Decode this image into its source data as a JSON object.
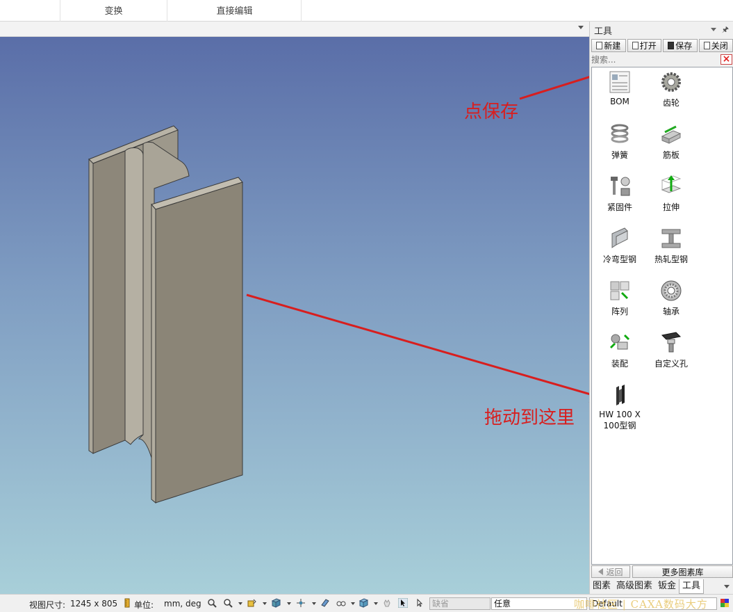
{
  "ribbon": {
    "tabs": [
      "变换",
      "直接编辑"
    ]
  },
  "panel": {
    "title": "工具",
    "pin_icon": "pin-icon",
    "toolbar": {
      "new_label": "新建",
      "open_label": "打开",
      "save_label": "保存",
      "close_label": "关闭"
    },
    "search": {
      "placeholder": "搜索...",
      "value": ""
    },
    "items": [
      {
        "label": "BOM",
        "icon": "bom-icon"
      },
      {
        "label": "齿轮",
        "icon": "gear-icon"
      },
      {
        "label": "弹簧",
        "icon": "spring-icon"
      },
      {
        "label": "筋板",
        "icon": "rib-icon"
      },
      {
        "label": "紧固件",
        "icon": "fastener-icon"
      },
      {
        "label": "拉伸",
        "icon": "extrude-icon"
      },
      {
        "label": "冷弯型钢",
        "icon": "cold-formed-steel-icon"
      },
      {
        "label": "热轧型钢",
        "icon": "hot-rolled-steel-icon"
      },
      {
        "label": "阵列",
        "icon": "array-icon"
      },
      {
        "label": "轴承",
        "icon": "bearing-icon"
      },
      {
        "label": "装配",
        "icon": "assembly-icon"
      },
      {
        "label": "自定义孔",
        "icon": "custom-hole-icon"
      },
      {
        "label": "HW 100 X 100型钢",
        "icon": "h-beam-icon"
      }
    ],
    "nav": {
      "back_label": "返回",
      "more_label": "更多图素库"
    },
    "tabs": [
      "图素",
      "高级图素",
      "钣金",
      "工具"
    ],
    "active_tab": "工具"
  },
  "annotations": {
    "save_hint": "点保存",
    "drag_hint": "拖动到这里"
  },
  "status": {
    "view_size_label": "视图尺寸:",
    "view_size_value": "1245 x  805",
    "unit_label": "单位:",
    "unit_value": "mm, deg",
    "combo_default_left": "缺省",
    "combo_any": "任意",
    "combo_default": "Default"
  },
  "watermark": "咖啡社区 | CAXA数码大方",
  "colors": {
    "annotation": "#d81e1e",
    "viewport_top": "#5a6ea8",
    "viewport_bottom": "#a8cfd9",
    "steel_face": "#8b8577"
  }
}
